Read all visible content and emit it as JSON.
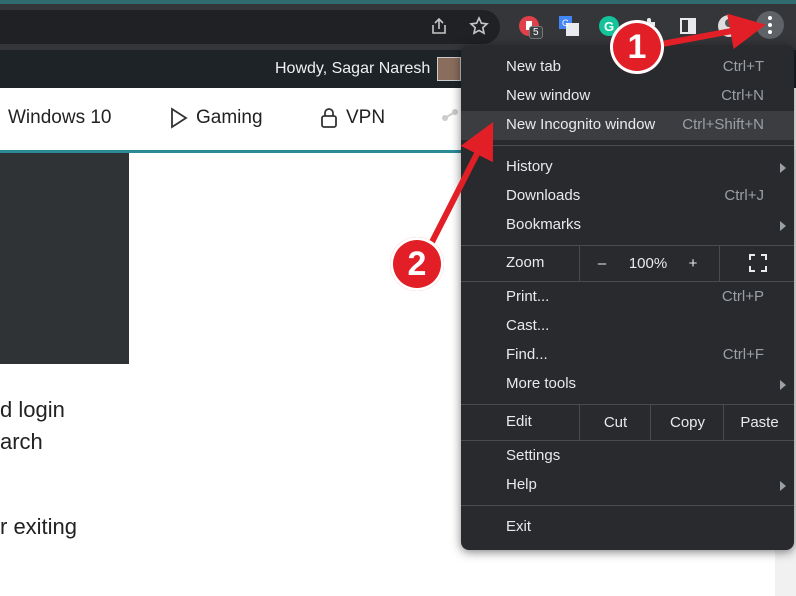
{
  "admin_bar": {
    "greeting": "Howdy, Sagar Naresh"
  },
  "site_nav": {
    "items": [
      {
        "label": "Windows 10",
        "icon": "none"
      },
      {
        "label": "Gaming",
        "icon": "play-icon"
      },
      {
        "label": "VPN",
        "icon": "lock-icon"
      }
    ]
  },
  "page_text": {
    "line1": "d login",
    "line2": "arch",
    "line3": "r exiting"
  },
  "toolbar": {
    "extension_badge": "5",
    "icons": [
      "share-icon",
      "star-icon",
      "extension-red-icon",
      "google-translate-icon",
      "grammarly-icon",
      "puzzle-icon",
      "side-panel-icon",
      "profile-avatar",
      "menu-kebab-icon"
    ]
  },
  "menu": {
    "new_tab": {
      "label": "New tab",
      "shortcut": "Ctrl+T"
    },
    "new_window": {
      "label": "New window",
      "shortcut": "Ctrl+N"
    },
    "new_incognito": {
      "label": "New Incognito window",
      "shortcut": "Ctrl+Shift+N"
    },
    "history": {
      "label": "History"
    },
    "downloads": {
      "label": "Downloads",
      "shortcut": "Ctrl+J"
    },
    "bookmarks": {
      "label": "Bookmarks"
    },
    "zoom": {
      "label": "Zoom",
      "minus": "–",
      "value": "100%",
      "plus": "+"
    },
    "print": {
      "label": "Print...",
      "shortcut": "Ctrl+P"
    },
    "cast": {
      "label": "Cast..."
    },
    "find": {
      "label": "Find...",
      "shortcut": "Ctrl+F"
    },
    "more_tools": {
      "label": "More tools"
    },
    "edit": {
      "label": "Edit",
      "cut": "Cut",
      "copy": "Copy",
      "paste": "Paste"
    },
    "settings": {
      "label": "Settings"
    },
    "help": {
      "label": "Help"
    },
    "exit": {
      "label": "Exit"
    }
  },
  "annotations": {
    "marker1": "1",
    "marker2": "2",
    "color": "#e21f26"
  }
}
